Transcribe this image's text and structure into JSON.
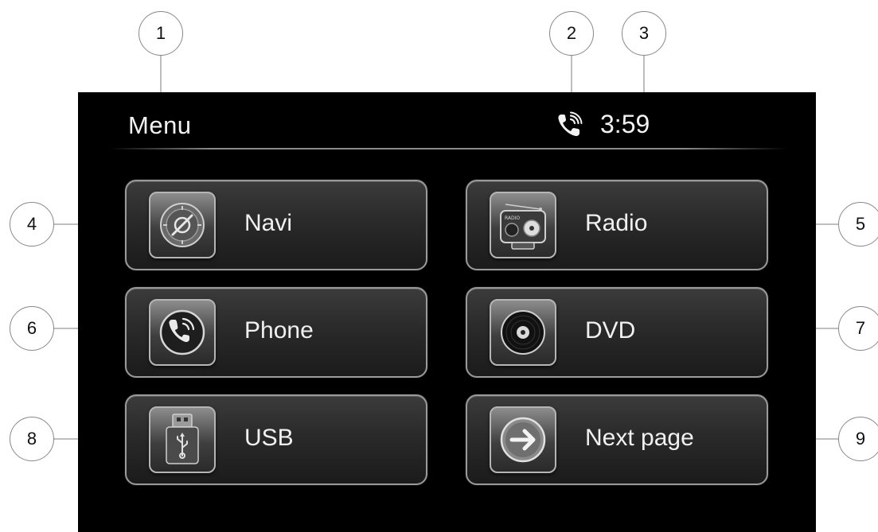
{
  "screen": {
    "title": "Menu",
    "status": {
      "phone_icon": "phone-call-icon",
      "clock": "3:59"
    }
  },
  "tiles": [
    {
      "label": "Navi",
      "icon": "compass-icon"
    },
    {
      "label": "Radio",
      "icon": "radio-icon"
    },
    {
      "label": "Phone",
      "icon": "phone-icon"
    },
    {
      "label": "DVD",
      "icon": "disc-icon"
    },
    {
      "label": "USB",
      "icon": "usb-icon"
    },
    {
      "label": "Next page",
      "icon": "arrow-right-icon"
    }
  ],
  "icon_text": {
    "radio": "RADIO"
  },
  "callouts": [
    "1",
    "2",
    "3",
    "4",
    "5",
    "6",
    "7",
    "8",
    "9"
  ],
  "colors": {
    "screen_bg": "#000000",
    "tile_border": "#9a9a9a",
    "text": "#f0f0f0"
  }
}
